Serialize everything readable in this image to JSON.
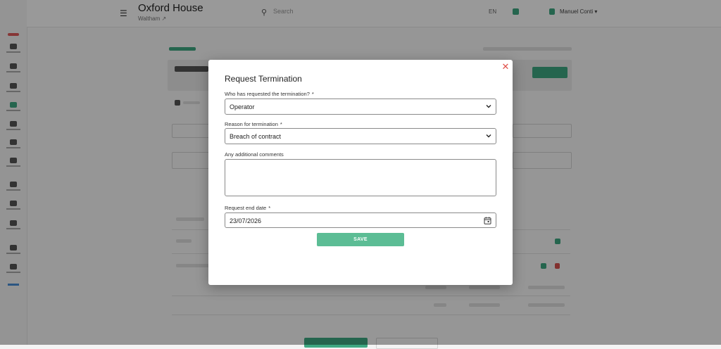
{
  "topbar": {
    "menu_icon": "hamburger-icon",
    "title": "Oxford House",
    "subtitle": "Waltham ↗",
    "search_placeholder": "Search",
    "language": "EN",
    "user_name": "Manuel Conti ▾"
  },
  "modal": {
    "title": "Request Termination",
    "close_icon": "close-icon",
    "fields": {
      "requester": {
        "label": "Who has requested the termination?",
        "required_mark": "*",
        "value": "Operator"
      },
      "reason": {
        "label": "Reason for termination",
        "required_mark": "*",
        "value": "Breach of contract"
      },
      "comments": {
        "label": "Any additional comments",
        "value": ""
      },
      "end_date": {
        "label": "Request end date",
        "required_mark": "*",
        "value": "23/07/2026"
      }
    },
    "save_label": "SAVE"
  },
  "colors": {
    "accent": "#5cbd95",
    "close": "#e0504a",
    "overlay": "rgba(0,0,0,0.40)"
  }
}
